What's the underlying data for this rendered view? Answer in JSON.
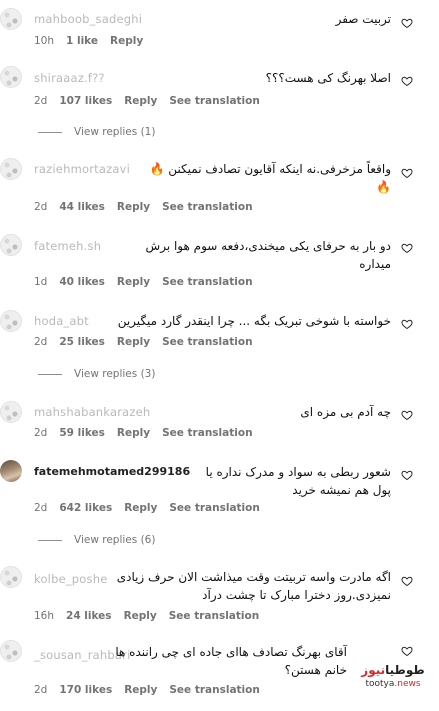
{
  "comments": [
    {
      "username": "mahboob_sadeghi",
      "text": "تربیت صفر",
      "time": "10h",
      "likes": "1 like",
      "reply": "Reply",
      "see_translation": ""
    },
    {
      "username": "shiraaaz.f??",
      "text": "اصلا بهرنگ کی هست؟؟؟",
      "time": "2d",
      "likes": "107 likes",
      "reply": "Reply",
      "see_translation": "See translation"
    },
    {
      "username": "raziehmortazavi",
      "text": "واقعاً مزخرفی.نه اینکه آقایون تصادف نمیکنن 🔥\n🔥",
      "time": "2d",
      "likes": "44 likes",
      "reply": "Reply",
      "see_translation": "See translation"
    },
    {
      "username": "fatemeh.sh",
      "text": "دو بار به حرفای یکی میخندی،دفعه سوم هوا برش\nمیداره",
      "time": "1d",
      "likes": "40 likes",
      "reply": "Reply",
      "see_translation": "See translation"
    },
    {
      "username": "hoda_abt",
      "text": "خواسته با شوخی تبریک بگه ... چرا اینقدر گارد میگیرین",
      "time": "2d",
      "likes": "25 likes",
      "reply": "Reply",
      "see_translation": "See translation"
    },
    {
      "username": "mahshabankarazeh",
      "text": "چه آدم بی مزه ای",
      "time": "2d",
      "likes": "59 likes",
      "reply": "Reply",
      "see_translation": "See translation"
    },
    {
      "username": "fatemehmotamed299186",
      "text": "شعور ربطی به سواد و مدرک نداره یا\nپول هم نمیشه خرید",
      "time": "2d",
      "likes": "642 likes",
      "reply": "Reply",
      "see_translation": "See translation"
    },
    {
      "username": "kolbe_poshe",
      "text": "اگه مادرت واسه تربیتت وقت میذاشت الان حرف زیادی\nنمیزدی.روز دخترا مبارک تا چشت درآد",
      "time": "16h",
      "likes": "24 likes",
      "reply": "Reply",
      "see_translation": "See translation"
    },
    {
      "username": "_sousan_rahbari",
      "text": "آقای بهرنگ تصادف هاای جاده ای چی راننده ها\nخانم هستن؟",
      "time": "2d",
      "likes": "170 likes",
      "reply": "Reply",
      "see_translation": "See translation"
    }
  ],
  "view_replies": [
    "View replies (1)",
    "View replies (3)",
    "View replies (6)"
  ],
  "watermark": {
    "logo_black": "طوطیا",
    "logo_red": "نیوز",
    "site_black": "tootya",
    "site_red": ".news"
  }
}
